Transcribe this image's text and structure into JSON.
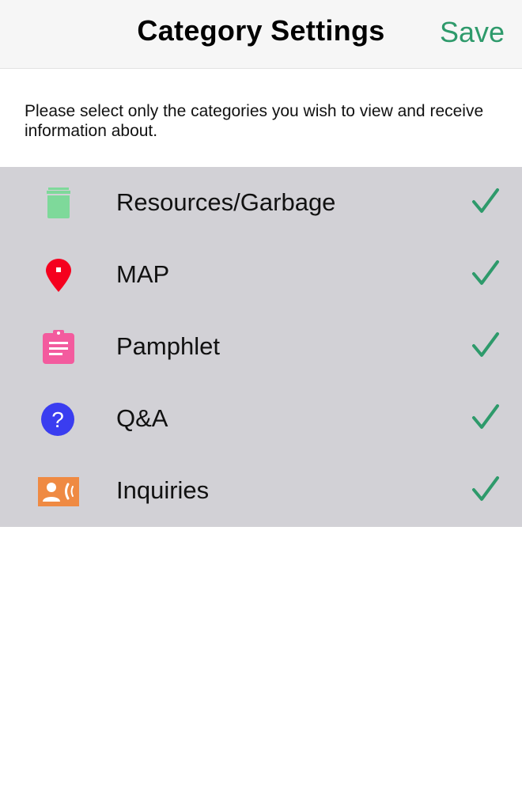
{
  "header": {
    "title": "Category Settings",
    "save_label": "Save",
    "accent_color": "#2e9a6b"
  },
  "intro_text": "Please select only the categories you wish to view and receive information about.",
  "categories": [
    {
      "label": "Resources/Garbage",
      "icon": "trash-icon",
      "icon_color": "#7ed99a",
      "checked": true
    },
    {
      "label": "MAP",
      "icon": "map-pin-icon",
      "icon_color": "#f5001e",
      "checked": true
    },
    {
      "label": "Pamphlet",
      "icon": "clipboard-icon",
      "icon_color": "#f35b9e",
      "checked": true
    },
    {
      "label": "Q&A",
      "icon": "question-circle-icon",
      "icon_color": "#3a3df0",
      "checked": true
    },
    {
      "label": "Inquiries",
      "icon": "contact-phone-icon",
      "icon_color": "#ef8a43",
      "checked": true
    }
  ]
}
